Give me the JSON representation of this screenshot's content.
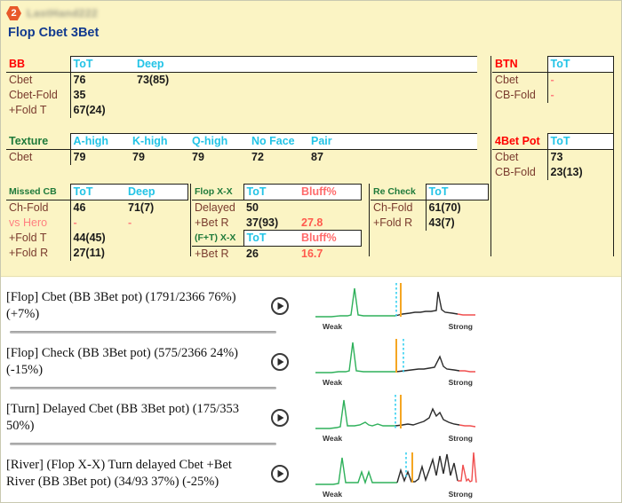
{
  "window": {
    "badge_number": "2",
    "username": "LastHand222",
    "title": "Flop Cbet 3Bet"
  },
  "colors": {
    "panel_bg": "#fbf4c4",
    "title": "#123a8f",
    "header_cyan": "#22c3e6",
    "bluff_red": "#ff6b6b",
    "section_red": "#ff0000",
    "section_green": "#1f7a3a",
    "row_label": "#7a3b2e",
    "badge_orange": "#e8582a"
  },
  "blocks": {
    "bb": {
      "name": "BB",
      "headers": [
        "ToT",
        "Deep"
      ],
      "rows": [
        {
          "label": "Cbet",
          "values": [
            "76",
            "73(85)"
          ]
        },
        {
          "label": "Cbet-Fold",
          "values": [
            "35",
            ""
          ]
        },
        {
          "label": "+Fold T",
          "values": [
            "67(24)",
            ""
          ]
        }
      ]
    },
    "btn": {
      "name": "BTN",
      "headers": [
        "ToT"
      ],
      "rows": [
        {
          "label": "Cbet",
          "values": [
            "-"
          ]
        },
        {
          "label": "CB-Fold",
          "values": [
            "-"
          ]
        }
      ]
    },
    "texture": {
      "name": "Texture",
      "headers": [
        "A-high",
        "K-high",
        "Q-high",
        "No Face",
        "Pair"
      ],
      "rows": [
        {
          "label": "Cbet",
          "values": [
            "79",
            "79",
            "79",
            "72",
            "87"
          ]
        }
      ]
    },
    "fourbet_pot": {
      "name": "4Bet Pot",
      "headers": [
        "ToT"
      ],
      "rows": [
        {
          "label": "Cbet",
          "values": [
            "73"
          ]
        },
        {
          "label": "CB-Fold",
          "values": [
            "23(13)"
          ]
        }
      ]
    },
    "missed_cb": {
      "name": "Missed CB",
      "headers": [
        "ToT",
        "Deep"
      ],
      "rows": [
        {
          "label": "Ch-Fold",
          "values": [
            "46",
            "71(7)"
          ]
        },
        {
          "label": "vs Hero",
          "values": [
            "-",
            "-"
          ]
        },
        {
          "label": "+Fold T",
          "values": [
            "44(45)",
            ""
          ]
        },
        {
          "label": "+Fold R",
          "values": [
            "27(11)",
            ""
          ]
        }
      ]
    },
    "flop_xx": {
      "name": "Flop X-X",
      "headers": [
        "ToT",
        "Bluff%"
      ],
      "rows": [
        {
          "label": "Delayed",
          "values": [
            "50",
            ""
          ]
        },
        {
          "label": "+Bet R",
          "values": [
            "37(93)",
            "27.8"
          ]
        }
      ]
    },
    "ft_xx": {
      "name": "(F+T) X-X",
      "headers": [
        "ToT",
        "Bluff%"
      ],
      "rows": [
        {
          "label": "+Bet R",
          "values": [
            "26",
            "16.7"
          ]
        }
      ]
    },
    "re_check": {
      "name": "Re Check",
      "headers": [
        "ToT"
      ],
      "rows": [
        {
          "label": "Ch-Fold",
          "values": [
            "61(70)"
          ]
        },
        {
          "label": "+Fold R",
          "values": [
            "43(7)"
          ]
        }
      ]
    }
  },
  "hand_list": {
    "axis_left_label": "Weak",
    "axis_right_label": "Strong",
    "play_icon": "play-circle-icon",
    "rows": [
      {
        "text": "[Flop] Cbet (BB 3Bet pot) (1791/2366 76%) (+7%)",
        "street": "Flop",
        "action": "Cbet",
        "context": "BB 3Bet pot",
        "count": "1791/2366",
        "percent": "76%",
        "delta": "+7%"
      },
      {
        "text": "[Flop] Check (BB 3Bet pot) (575/2366 24%) (-15%)",
        "street": "Flop",
        "action": "Check",
        "context": "BB 3Bet pot",
        "count": "575/2366",
        "percent": "24%",
        "delta": "-15%"
      },
      {
        "text": "[Turn] Delayed Cbet (BB 3Bet pot) (175/353 50%)",
        "street": "Turn",
        "action": "Delayed Cbet",
        "context": "BB 3Bet pot",
        "count": "175/353",
        "percent": "50%",
        "delta": ""
      },
      {
        "text": "[River] (Flop X-X) Turn delayed Cbet +Bet River (BB 3Bet pot) (34/93 37%) (-25%)",
        "street": "River",
        "action": "(Flop X-X) Turn delayed Cbet +Bet River",
        "context": "BB 3Bet pot",
        "count": "34/93",
        "percent": "37%",
        "delta": "-25%"
      }
    ]
  },
  "chart_data": [
    {
      "type": "line",
      "title": "[Flop] Cbet (BB 3Bet pot) equity distribution",
      "xlabel": "",
      "ylabel": "",
      "axis_ticks": [
        "Weak",
        "Strong"
      ],
      "grid": false,
      "legend": "none",
      "xlim": [
        0,
        100
      ],
      "ylim": [
        0,
        1
      ],
      "markers": [
        {
          "name": "orange-marker",
          "x": 47,
          "color": "#f5a623"
        },
        {
          "name": "cyan-dashed-marker",
          "x": 45,
          "color": "#35d0f0"
        }
      ],
      "segments": [
        {
          "name": "weak",
          "color": "#2eb05a",
          "x": [
            0,
            4,
            8,
            12,
            16,
            18,
            20,
            22,
            24,
            26,
            30,
            34,
            38,
            42,
            44
          ],
          "y": [
            0.04,
            0.04,
            0.04,
            0.05,
            0.05,
            0.06,
            0.72,
            0.06,
            0.05,
            0.05,
            0.05,
            0.05,
            0.05,
            0.05,
            0.05
          ]
        },
        {
          "name": "mid",
          "color": "#2b2b2b",
          "x": [
            44,
            48,
            52,
            56,
            60,
            64,
            68,
            72,
            74,
            76,
            78,
            82,
            86
          ],
          "y": [
            0.05,
            0.08,
            0.1,
            0.11,
            0.11,
            0.12,
            0.12,
            0.13,
            0.62,
            0.14,
            0.1,
            0.09,
            0.08
          ]
        },
        {
          "name": "strong",
          "color": "#f04e4e",
          "x": [
            86,
            90,
            94,
            98,
            100
          ],
          "y": [
            0.08,
            0.07,
            0.07,
            0.07,
            0.07
          ]
        }
      ]
    },
    {
      "type": "line",
      "title": "[Flop] Check (BB 3Bet pot) equity distribution",
      "xlabel": "",
      "ylabel": "",
      "axis_ticks": [
        "Weak",
        "Strong"
      ],
      "grid": false,
      "legend": "none",
      "xlim": [
        0,
        100
      ],
      "ylim": [
        0,
        1
      ],
      "markers": [
        {
          "name": "orange-marker",
          "x": 45,
          "color": "#f5a623"
        },
        {
          "name": "cyan-dashed-marker",
          "x": 50,
          "color": "#35d0f0"
        }
      ],
      "segments": [
        {
          "name": "weak",
          "color": "#2eb05a",
          "x": [
            0,
            4,
            8,
            12,
            16,
            18,
            20,
            22,
            26,
            30,
            34,
            38,
            42,
            45
          ],
          "y": [
            0.05,
            0.05,
            0.05,
            0.05,
            0.06,
            0.07,
            0.8,
            0.07,
            0.05,
            0.05,
            0.05,
            0.05,
            0.05,
            0.05
          ]
        },
        {
          "name": "mid",
          "color": "#2b2b2b",
          "x": [
            45,
            50,
            55,
            60,
            64,
            68,
            72,
            76,
            78,
            80,
            84,
            88
          ],
          "y": [
            0.05,
            0.07,
            0.08,
            0.09,
            0.09,
            0.1,
            0.12,
            0.4,
            0.14,
            0.1,
            0.08,
            0.07
          ]
        },
        {
          "name": "strong",
          "color": "#f04e4e",
          "x": [
            88,
            92,
            96,
            100
          ],
          "y": [
            0.07,
            0.07,
            0.06,
            0.06
          ]
        }
      ]
    },
    {
      "type": "line",
      "title": "[Turn] Delayed Cbet (BB 3Bet pot) equity distribution",
      "xlabel": "",
      "ylabel": "",
      "axis_ticks": [
        "Weak",
        "Strong"
      ],
      "grid": false,
      "legend": "none",
      "xlim": [
        0,
        100
      ],
      "ylim": [
        0,
        1
      ],
      "markers": [
        {
          "name": "orange-marker",
          "x": 53,
          "color": "#f5a623"
        },
        {
          "name": "cyan-dashed-marker",
          "x": 50,
          "color": "#35d0f0"
        }
      ],
      "segments": [
        {
          "name": "weak",
          "color": "#2eb05a",
          "x": [
            0,
            5,
            10,
            14,
            16,
            18,
            22,
            26,
            30,
            34,
            36,
            38,
            42,
            46,
            50
          ],
          "y": [
            0.05,
            0.05,
            0.05,
            0.06,
            0.78,
            0.08,
            0.1,
            0.12,
            0.16,
            0.2,
            0.13,
            0.12,
            0.14,
            0.12,
            0.12
          ]
        },
        {
          "name": "mid",
          "color": "#2b2b2b",
          "x": [
            50,
            54,
            58,
            62,
            66,
            70,
            74,
            76,
            78,
            80,
            82,
            86,
            88,
            90
          ],
          "y": [
            0.12,
            0.14,
            0.16,
            0.14,
            0.18,
            0.22,
            0.3,
            0.55,
            0.34,
            0.4,
            0.24,
            0.18,
            0.14,
            0.12
          ]
        },
        {
          "name": "strong",
          "color": "#f04e4e",
          "x": [
            90,
            93,
            96,
            100
          ],
          "y": [
            0.1,
            0.09,
            0.09,
            0.08
          ]
        }
      ]
    },
    {
      "type": "line",
      "title": "[River] (Flop X-X) Turn delayed Cbet +Bet River (BB 3Bet pot) equity distribution",
      "xlabel": "",
      "ylabel": "",
      "axis_ticks": [
        "Weak",
        "Strong"
      ],
      "grid": false,
      "legend": "none",
      "xlim": [
        0,
        100
      ],
      "ylim": [
        0,
        1
      ],
      "markers": [
        {
          "name": "orange-marker",
          "x": 57,
          "color": "#f5a623"
        },
        {
          "name": "cyan-dashed-marker",
          "x": 53,
          "color": "#35d0f0"
        }
      ],
      "segments": [
        {
          "name": "weak",
          "color": "#2eb05a",
          "x": [
            0,
            6,
            12,
            16,
            18,
            20,
            24,
            28,
            30,
            32,
            34,
            36,
            38,
            42,
            46,
            50
          ],
          "y": [
            0.05,
            0.05,
            0.05,
            0.06,
            0.7,
            0.08,
            0.06,
            0.3,
            0.08,
            0.28,
            0.08,
            0.06,
            0.06,
            0.06,
            0.06,
            0.06
          ]
        },
        {
          "name": "mid",
          "color": "#2b2b2b",
          "x": [
            50,
            52,
            54,
            56,
            58,
            60,
            62,
            64,
            66,
            68,
            70,
            72,
            74,
            76,
            78,
            80,
            82,
            84
          ],
          "y": [
            0.06,
            0.3,
            0.1,
            0.26,
            0.08,
            0.07,
            0.1,
            0.45,
            0.12,
            0.35,
            0.6,
            0.2,
            0.75,
            0.25,
            0.8,
            0.18,
            0.55,
            0.12
          ]
        },
        {
          "name": "strong",
          "color": "#f04e4e",
          "x": [
            84,
            86,
            88,
            90,
            92,
            94,
            96,
            98,
            100
          ],
          "y": [
            0.12,
            0.5,
            0.14,
            0.45,
            0.16,
            0.12,
            0.14,
            0.85,
            0.1
          ]
        }
      ]
    }
  ]
}
